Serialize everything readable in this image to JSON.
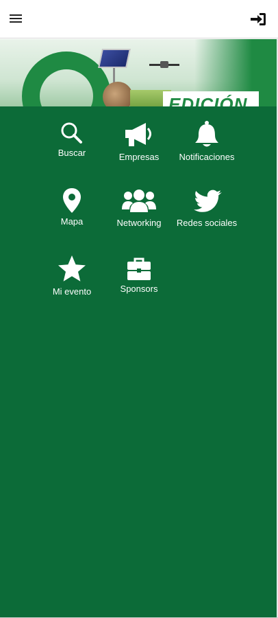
{
  "header": {
    "menu_icon": "hamburger-menu-icon",
    "login_icon": "sign-in-icon"
  },
  "banner": {
    "heading_text": "EDICIÓN"
  },
  "menu": {
    "items": [
      {
        "label": "Buscar",
        "icon": "search-icon"
      },
      {
        "label": "Empresas",
        "icon": "megaphone-icon"
      },
      {
        "label": "Notificaciones",
        "icon": "bell-icon"
      },
      {
        "label": "Mapa",
        "icon": "map-marker-icon"
      },
      {
        "label": "Networking",
        "icon": "users-icon"
      },
      {
        "label": "Redes sociales",
        "icon": "twitter-icon"
      },
      {
        "label": "Mi evento",
        "icon": "star-icon"
      },
      {
        "label": "Sponsors",
        "icon": "briefcase-icon"
      }
    ]
  },
  "colors": {
    "panel_background": "#0c6b38",
    "icon_color": "#ffffff",
    "brand_green": "#1f8a43"
  }
}
